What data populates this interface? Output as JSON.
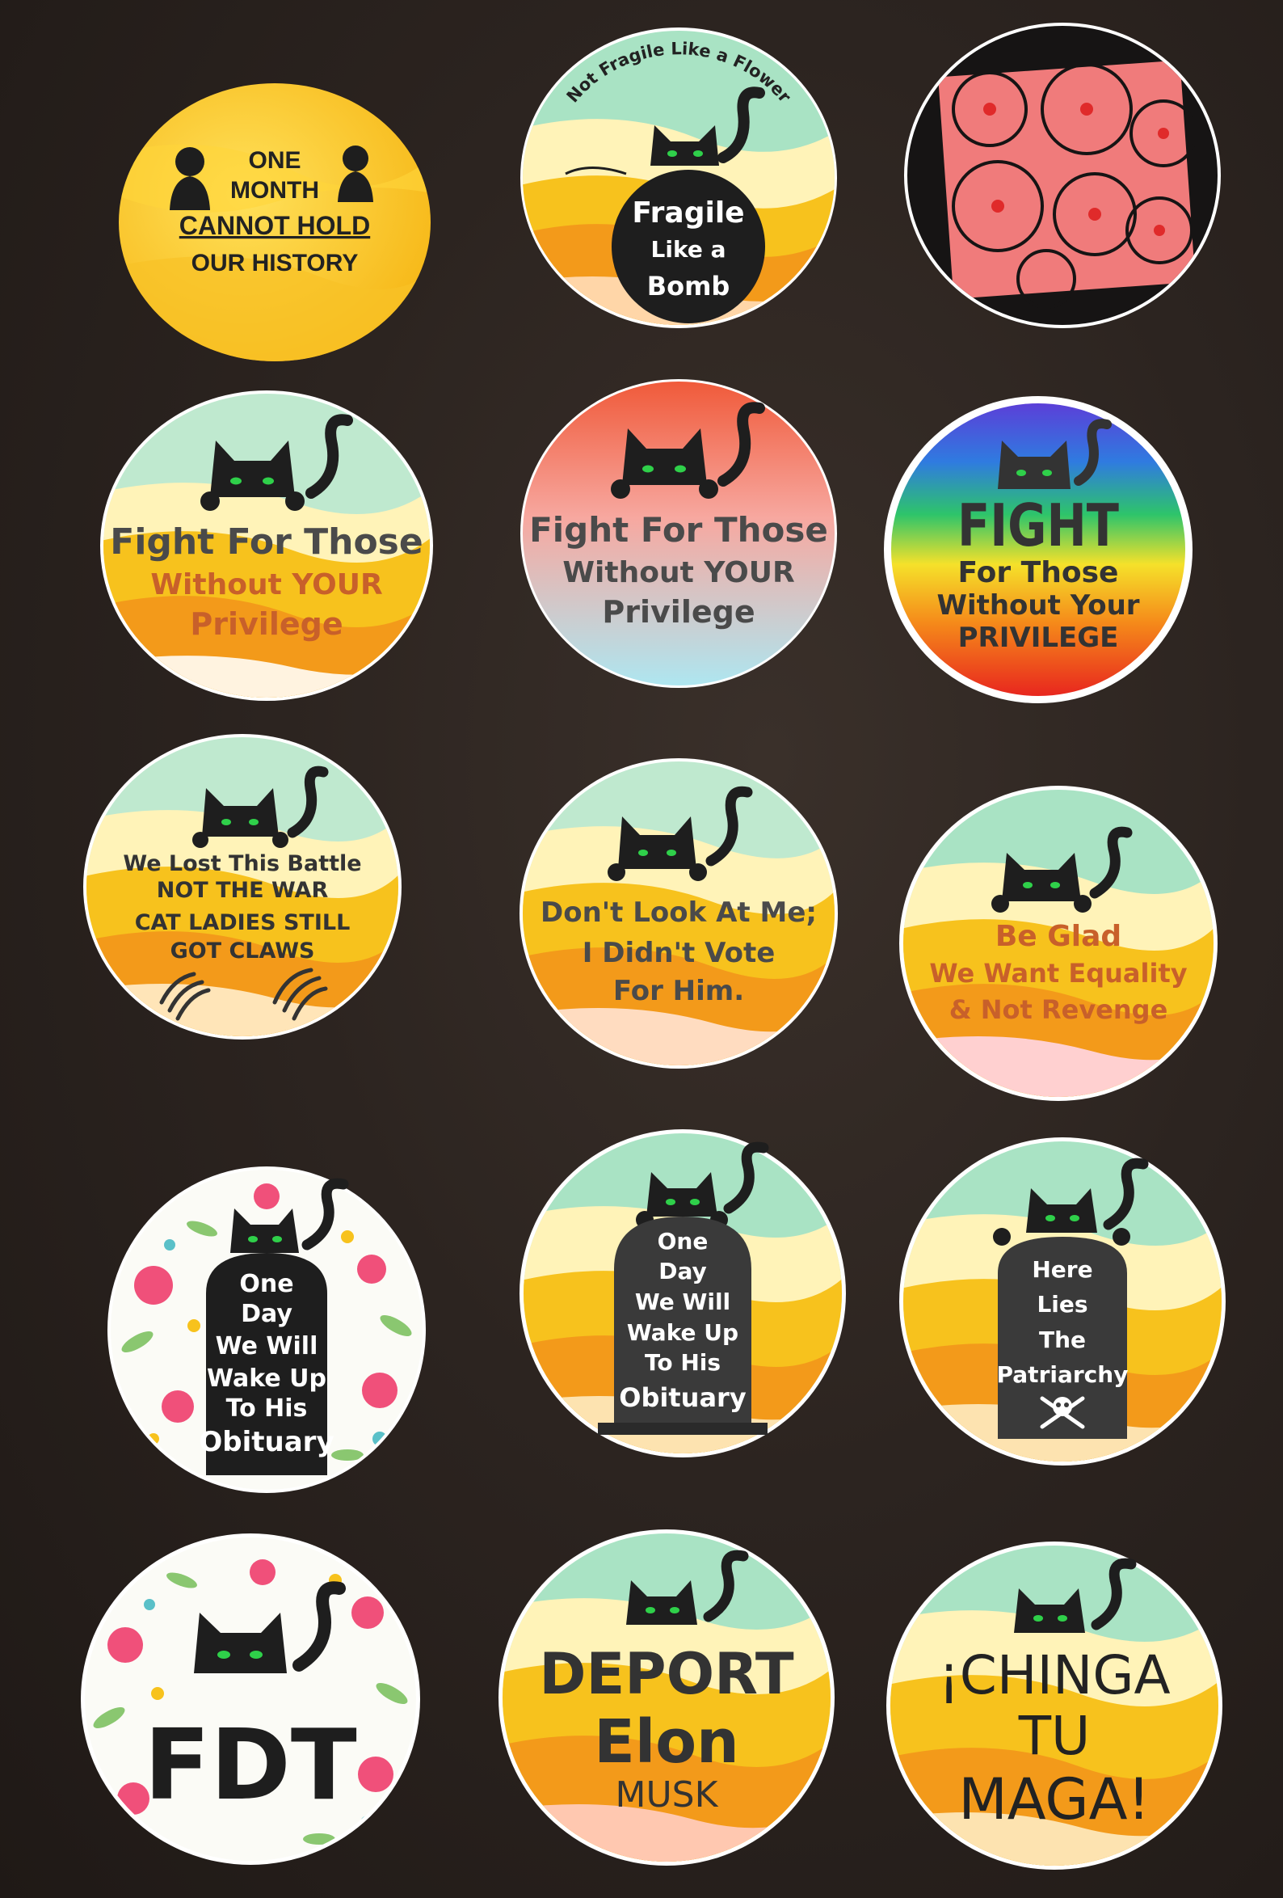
{
  "stickers": {
    "s1": {
      "lines": [
        "ONE",
        "MONTH",
        "CANNOT HOLD",
        "OUR HISTORY"
      ]
    },
    "s2": {
      "arc": "Not Fragile Like a Flower",
      "lines": [
        "Fragile",
        "Like a",
        "Bomb"
      ]
    },
    "s4": {
      "lines": [
        "Fight For Those",
        "Without YOUR",
        "Privilege"
      ]
    },
    "s5": {
      "lines": [
        "Fight For Those",
        "Without YOUR",
        "Privilege"
      ]
    },
    "s6": {
      "lines": [
        "FIGHT",
        "For Those",
        "Without Your",
        "PRIVILEGE"
      ]
    },
    "s7": {
      "lines": [
        "We Lost This Battle",
        "NOT THE WAR",
        "CAT LADIES STILL",
        "GOT CLAWS"
      ]
    },
    "s8": {
      "lines": [
        "Don't Look At Me;",
        "I Didn't Vote",
        "For Him."
      ]
    },
    "s9": {
      "lines": [
        "Be Glad",
        "We Want Equality",
        "& Not Revenge"
      ]
    },
    "s10": {
      "lines": [
        "One",
        "Day",
        "We Will",
        "Wake Up",
        "To His",
        "Obituary"
      ]
    },
    "s11": {
      "lines": [
        "One",
        "Day",
        "We Will",
        "Wake Up",
        "To His",
        "Obituary"
      ]
    },
    "s12": {
      "lines": [
        "Here",
        "Lies",
        "The",
        "Patriarchy"
      ]
    },
    "s13": {
      "lines": [
        "FDT"
      ]
    },
    "s14": {
      "lines": [
        "DEPORT",
        "Elon",
        "MUSK"
      ]
    },
    "s15": {
      "lines": [
        "¡CHINGA",
        "TU",
        "MAGA!"
      ]
    }
  },
  "colors": {
    "background": "#2c2420",
    "cat": "#1e1e1e",
    "cat_eyes": "#2fd04a",
    "orange_text": "#c8602a",
    "yellow": "#f7c21d",
    "orange": "#f39a1a",
    "mint": "#a9e3c4",
    "flower_pink": "#f07b7b"
  }
}
